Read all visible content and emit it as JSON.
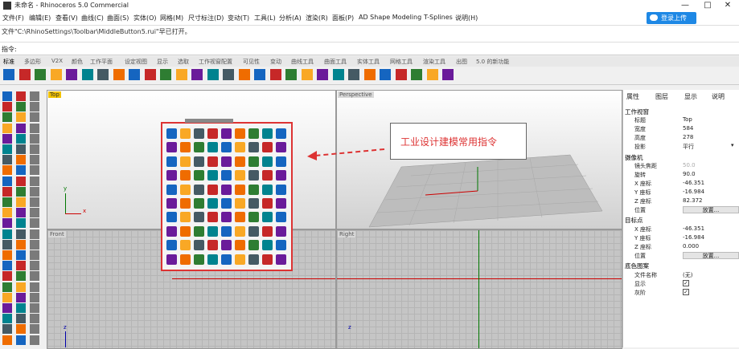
{
  "app": {
    "title": "未命名 - Rhinoceros 5.0 Commercial",
    "window_controls": [
      "—",
      "□",
      "✕"
    ]
  },
  "menu": {
    "items": [
      "文件(F)",
      "编辑(E)",
      "查看(V)",
      "曲线(C)",
      "曲面(S)",
      "实体(O)",
      "网格(M)",
      "尺寸标注(D)",
      "变动(T)",
      "工具(L)",
      "分析(A)",
      "渲染(R)",
      "面板(P)",
      "AD Shape Modeling",
      "T-Splines",
      "说明(H)"
    ],
    "login_label": "登录上传"
  },
  "command": {
    "history": "文件\"C:\\RhinoSettings\\Toolbar\\MiddleButton5.rui\"早已打开。",
    "prompt": "指令:"
  },
  "tabs": {
    "items": [
      "标准",
      "多边形",
      "V2X",
      "颜色",
      "工作平面",
      "设定视图",
      "显示",
      "选取",
      "工作视窗配置",
      "可见性",
      "变动",
      "曲线工具",
      "曲面工具",
      "实体工具",
      "网格工具",
      "渲染工具",
      "出图",
      "5.0 的新功能"
    ],
    "active_index": 0
  },
  "viewports": {
    "top_label": "Top",
    "perspective_label": "Perspective",
    "front_label": "Front",
    "right_label": "Right",
    "axis_x": "x",
    "axis_y": "y",
    "axis_z": "z"
  },
  "callout": {
    "text": "工业设计建模常用指令"
  },
  "panel": {
    "tabs": [
      "属性",
      "图层",
      "显示",
      "说明"
    ],
    "viewport_section": "工作视窗",
    "title_label": "标题",
    "title_value": "Top",
    "width_label": "宽度",
    "width_value": "584",
    "height_label": "高度",
    "height_value": "278",
    "projection_label": "投影",
    "projection_value": "平行",
    "camera_section": "摄像机",
    "lens_label": "镜头焦距",
    "lens_value": "50.0",
    "rotation_label": "旋转",
    "rotation_value": "90.0",
    "cam_x_label": "X 座标",
    "cam_x_value": "-46.351",
    "cam_y_label": "Y 座标",
    "cam_y_value": "-16.984",
    "cam_z_label": "Z 座标",
    "cam_z_value": "82.372",
    "cam_location_label": "位置",
    "cam_location_button": "放置...",
    "target_section": "目标点",
    "tgt_x_label": "X 座标",
    "tgt_x_value": "-46.351",
    "tgt_y_label": "Y 座标",
    "tgt_y_value": "-16.984",
    "tgt_z_label": "Z 座标",
    "tgt_z_value": "0.000",
    "tgt_location_label": "位置",
    "tgt_location_button": "放置...",
    "wallpaper_section": "底色图案",
    "filename_label": "文件名称",
    "filename_value": "(无)",
    "show_label": "显示",
    "gray_label": "灰阶"
  },
  "colors": {
    "accent": "#1e88e5",
    "highlight_red": "#dd3333",
    "top_label_bg": "#f2c200"
  },
  "toolbar_icons": [
    "new-icon",
    "open-icon",
    "save-icon",
    "print-icon",
    "import-icon",
    "cut-icon",
    "copy-icon",
    "paste-icon",
    "undo-icon",
    "pan-icon",
    "rotate-icon",
    "zoom-icon",
    "zoom-window-icon",
    "zoom-extents-icon",
    "zoom-selected-icon",
    "set-view-icon",
    "four-view-icon",
    "cplane-icon",
    "grid-icon",
    "osnap-icon",
    "ortho-icon",
    "layer-icon",
    "properties-icon",
    "light-icon",
    "shade-icon",
    "render-icon",
    "material-icon",
    "options-icon",
    "help-icon"
  ],
  "palette_icon_count": 90
}
